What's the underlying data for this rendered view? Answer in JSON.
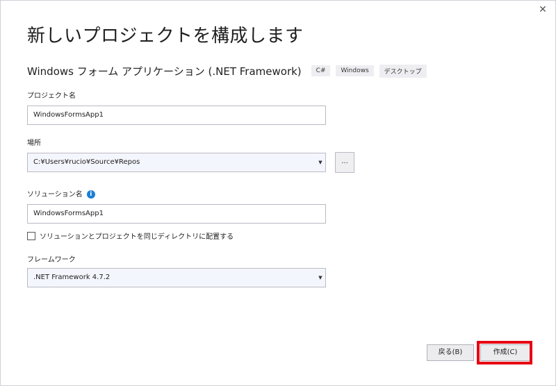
{
  "window": {
    "close_glyph": "✕",
    "title": "新しいプロジェクトを構成します"
  },
  "template": {
    "name": "Windows フォーム アプリケーション (.NET Framework)",
    "tags": [
      "C#",
      "Windows",
      "デスクトップ"
    ]
  },
  "form": {
    "project_name": {
      "label": "プロジェクト名",
      "value": "WindowsFormsApp1"
    },
    "location": {
      "label": "場所",
      "value": "C:¥Users¥rucio¥Source¥Repos",
      "browse_label": "..."
    },
    "solution_name": {
      "label": "ソリューション名",
      "value": "WindowsFormsApp1"
    },
    "same_directory": {
      "label": "ソリューションとプロジェクトを同じディレクトリに配置する",
      "checked": false
    },
    "framework": {
      "label": "フレームワーク",
      "value": ".NET Framework 4.7.2"
    }
  },
  "buttons": {
    "back": "戻る(B)",
    "create": "作成(C)"
  },
  "colors": {
    "highlight": "#e60012",
    "info": "#1c7ed6"
  }
}
